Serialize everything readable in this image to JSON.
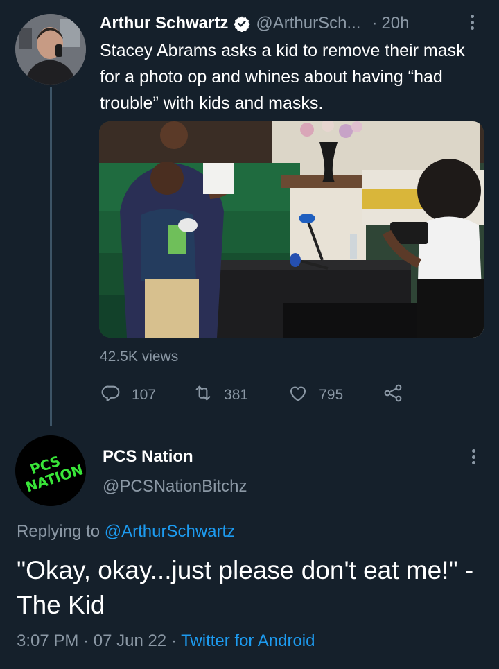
{
  "parent_tweet": {
    "author_name": "Arthur Schwartz",
    "handle": "@ArthurSch...",
    "time_separator": "·",
    "time": "20h",
    "text": "Stacey Abrams asks a kid to remove their mask for a photo op and whines about having “had trouble” with kids and masks.",
    "views": "42.5K views",
    "reply_count": "107",
    "retweet_count": "381",
    "like_count": "795"
  },
  "reply_tweet": {
    "author_name": "PCS Nation",
    "handle": "@PCSNationBitchz",
    "avatar_text_line1": "PCS",
    "avatar_text_line2": "NATION",
    "replying_prefix": "Replying to",
    "replying_to": "@ArthurSchwartz",
    "text": "\"Okay, okay...just please don't eat me!\" - The Kid",
    "time": "3:07 PM",
    "separator1": "·",
    "date": "07 Jun 22",
    "separator2": "·",
    "source": "Twitter for Android"
  },
  "colors": {
    "background": "#15202b",
    "secondary_text": "#8b98a5",
    "link": "#1d9bf0",
    "avatar_text": "#39e639"
  },
  "icons": {
    "verified": "verified-badge-icon",
    "reply": "reply-bubble-icon",
    "retweet": "retweet-icon",
    "like": "heart-icon",
    "share": "share-icon",
    "more": "kebab-menu-icon"
  }
}
